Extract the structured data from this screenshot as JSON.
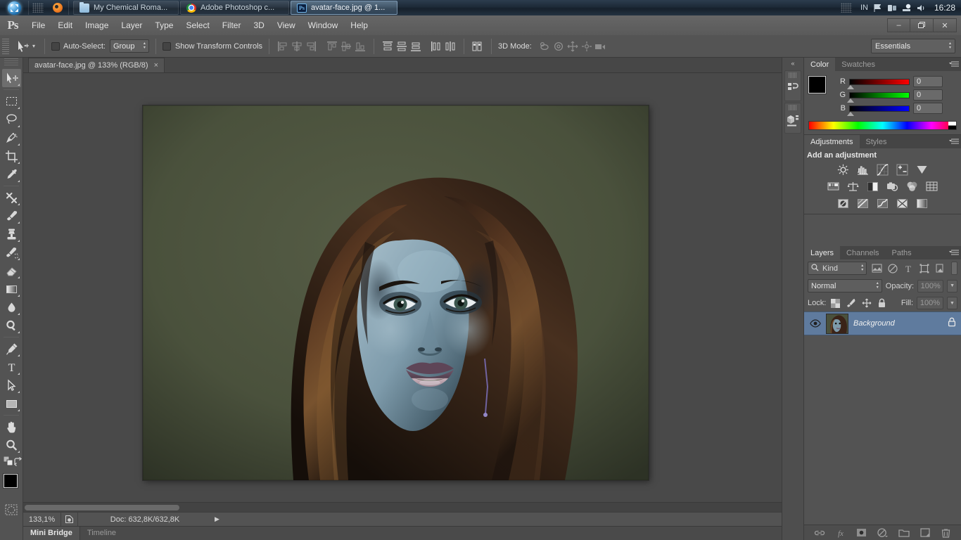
{
  "taskbar": {
    "start_label": "start-orb",
    "buttons": [
      {
        "label": "My Chemical Roma...",
        "icon": "folder-icon",
        "active": false
      },
      {
        "label": "Adobe Photoshop c...",
        "icon": "chrome-icon",
        "active": false
      },
      {
        "label": "avatar-face.jpg @ 1...",
        "icon": "photoshop-icon",
        "active": true
      }
    ],
    "tray": {
      "language": "IN",
      "clock": "16:28"
    }
  },
  "app": {
    "logo": "Ps",
    "menus": [
      "File",
      "Edit",
      "Image",
      "Layer",
      "Type",
      "Select",
      "Filter",
      "3D",
      "View",
      "Window",
      "Help"
    ],
    "window_controls": {
      "minimize": "–",
      "restore": "❐",
      "close": "✕"
    }
  },
  "options_bar": {
    "auto_select_label": "Auto-Select:",
    "auto_select_value": "Group",
    "auto_select_checked": false,
    "show_transform_label": "Show Transform Controls",
    "show_transform_checked": false,
    "mode_3d_label": "3D Mode:",
    "workspace": "Essentials"
  },
  "toolbar": {
    "tools": [
      "move-tool",
      "rectangular-marquee-tool",
      "lasso-tool",
      "quick-selection-tool",
      "crop-tool",
      "eyedropper-tool",
      "spot-healing-brush-tool",
      "brush-tool",
      "clone-stamp-tool",
      "history-brush-tool",
      "eraser-tool",
      "gradient-tool",
      "blur-tool",
      "dodge-tool",
      "pen-tool",
      "horizontal-type-tool",
      "path-selection-tool",
      "rectangle-tool",
      "hand-tool",
      "zoom-tool"
    ],
    "selected": "move-tool",
    "foreground_color": "#000000",
    "background_color": "#ffffff"
  },
  "document": {
    "tab_title": "avatar-face.jpg @ 133% (RGB/8)",
    "close_label": "×"
  },
  "status_bar": {
    "zoom": "133,1%",
    "doc_info": "Doc: 632,8K/632,8K"
  },
  "bottom_tabs": {
    "tabs": [
      {
        "label": "Mini Bridge",
        "active": true
      },
      {
        "label": "Timeline",
        "active": false
      }
    ]
  },
  "color_panel": {
    "tabs": [
      {
        "label": "Color",
        "active": true
      },
      {
        "label": "Swatches",
        "active": false
      }
    ],
    "channels": [
      {
        "label": "R",
        "value": "0"
      },
      {
        "label": "G",
        "value": "0"
      },
      {
        "label": "B",
        "value": "0"
      }
    ],
    "foreground": "#000000",
    "background": "#ffffff"
  },
  "adjustments_panel": {
    "tabs": [
      {
        "label": "Adjustments",
        "active": true
      },
      {
        "label": "Styles",
        "active": false
      }
    ],
    "title": "Add an adjustment",
    "row1": [
      "brightness-contrast-icon",
      "levels-icon",
      "curves-icon",
      "exposure-icon",
      "vibrance-icon"
    ],
    "row2": [
      "hue-saturation-icon",
      "color-balance-icon",
      "black-white-icon",
      "photo-filter-icon",
      "channel-mixer-icon",
      "color-lookup-icon"
    ],
    "row3": [
      "invert-icon",
      "posterize-icon",
      "threshold-icon",
      "gradient-map-icon",
      "selective-color-icon"
    ]
  },
  "layers_panel": {
    "tabs": [
      {
        "label": "Layers",
        "active": true
      },
      {
        "label": "Channels",
        "active": false
      },
      {
        "label": "Paths",
        "active": false
      }
    ],
    "filter_label": "Kind",
    "filter_icons": [
      "pixel-layers-filter-icon",
      "adjustment-layers-filter-icon",
      "type-layers-filter-icon",
      "shape-layers-filter-icon",
      "smart-object-filter-icon"
    ],
    "blend_mode": "Normal",
    "opacity_label": "Opacity:",
    "opacity_value": "100%",
    "lock_label": "Lock:",
    "fill_label": "Fill:",
    "fill_value": "100%",
    "lock_icons": [
      "lock-transparent-pixels-icon",
      "lock-image-pixels-icon",
      "lock-position-icon",
      "lock-all-icon"
    ],
    "layers": [
      {
        "name": "Background",
        "visible": true,
        "locked": true,
        "selected": true
      }
    ],
    "footer_icons": [
      "link-layers-icon",
      "layer-style-fx-icon",
      "add-layer-mask-icon",
      "new-adjustment-layer-icon",
      "new-group-icon",
      "new-layer-icon",
      "delete-layer-icon"
    ]
  },
  "mini_dock": {
    "collapse_label": "«",
    "panels": [
      "history-panel-icon",
      "properties-panel-icon"
    ]
  },
  "canvas": {
    "image_name": "avatar-face.jpg",
    "background_color": "#4a513c",
    "skin_color": "#7e9bab",
    "hair_color": "#3a2318"
  }
}
